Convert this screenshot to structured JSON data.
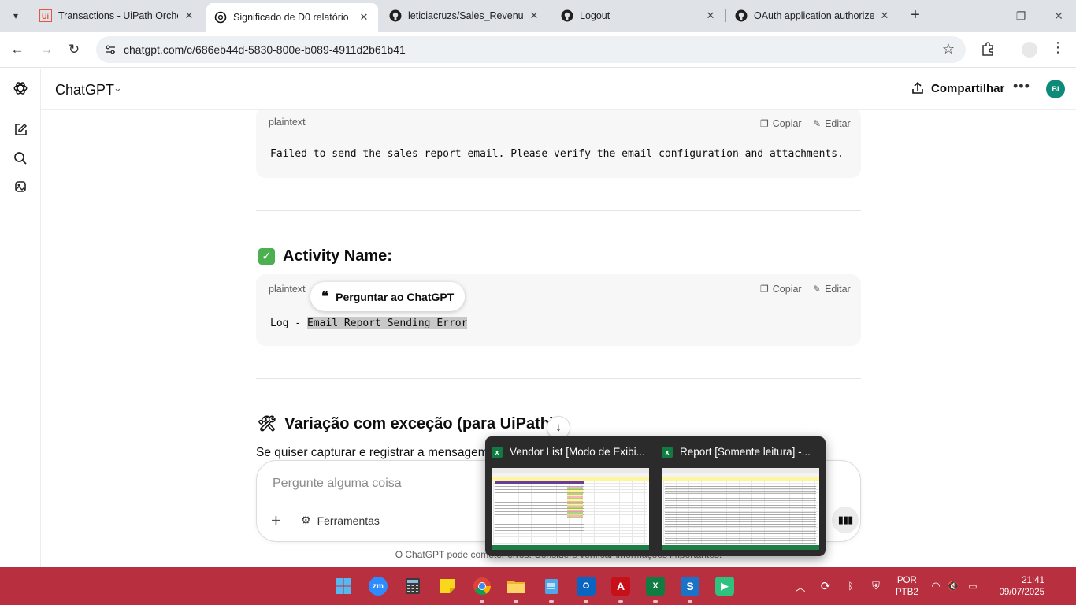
{
  "browser": {
    "tabs": [
      {
        "title": "Transactions - UiPath Orchestrator",
        "active": false
      },
      {
        "title": "Significado de D0 relatório",
        "active": true
      },
      {
        "title": "leticiacruzs/Sales_RevenueReport",
        "active": false
      },
      {
        "title": "Logout",
        "active": false
      },
      {
        "title": "OAuth application authorized",
        "active": false
      }
    ],
    "url": "chatgpt.com/c/686eb44d-5830-800e-b089-4911d2b61b41"
  },
  "app": {
    "model_label": "ChatGPT",
    "share_label": "Compartilhar",
    "avatar_initials": "BI"
  },
  "content": {
    "block1": {
      "lang": "plaintext",
      "copy_label": "Copiar",
      "edit_label": "Editar",
      "code": "Failed to send the sales report email. Please verify the email configuration and attachments."
    },
    "heading1": "Activity Name:",
    "block2": {
      "lang": "plaintext",
      "copy_label": "Copiar",
      "edit_label": "Editar",
      "code_prefix": "Log - ",
      "code_selected": "Email Report Sending Error"
    },
    "ask_popup": "Perguntar ao ChatGPT",
    "heading2": "Variação com exceção (para UiPath):",
    "paragraph": "Se quiser capturar e registrar a mensagem"
  },
  "composer": {
    "placeholder": "Pergunte alguma coisa",
    "tools_label": "Ferramentas"
  },
  "disclaimer": "O ChatGPT pode cometer erros. Considere verificar informações importantes.",
  "preview": {
    "items": [
      {
        "title": "Vendor List  [Modo de Exibi..."
      },
      {
        "title": "Report  [Somente leitura] -..."
      }
    ]
  },
  "taskbar": {
    "zoom_label": "zm",
    "language": "POR",
    "layout": "PTB2",
    "time": "21:41",
    "date": "09/07/2025"
  },
  "colors": {
    "taskbar": "#b83040",
    "excel": "#107c41",
    "accent_check": "#4caf50"
  }
}
